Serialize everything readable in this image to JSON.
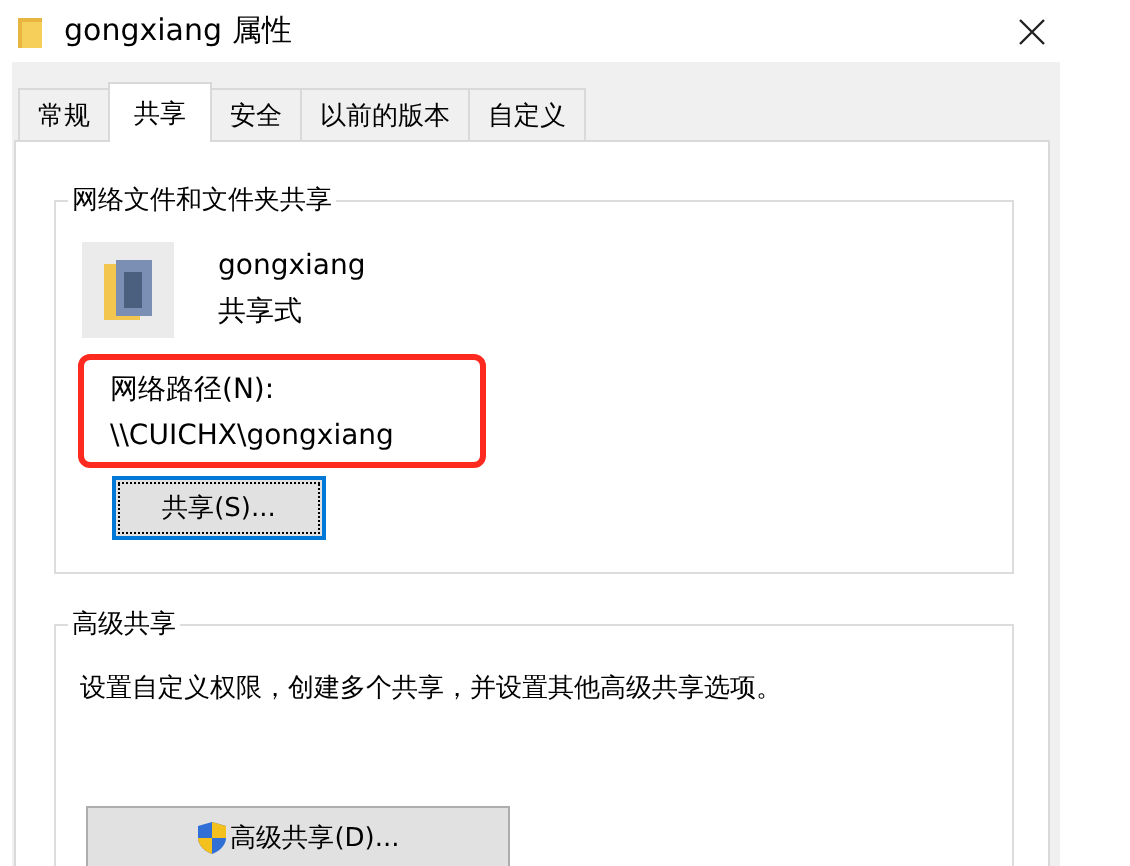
{
  "window": {
    "title": "gongxiang 属性"
  },
  "tabs": [
    {
      "label": "常规",
      "selected": false
    },
    {
      "label": "共享",
      "selected": true
    },
    {
      "label": "安全",
      "selected": false
    },
    {
      "label": "以前的版本",
      "selected": false
    },
    {
      "label": "自定义",
      "selected": false
    }
  ],
  "network_sharing": {
    "title": "网络文件和文件夹共享",
    "folder_name": "gongxiang",
    "share_status": "共享式",
    "network_path_label": "网络路径(N):",
    "network_path": "\\\\CUICHX\\gongxiang",
    "highlighted": true,
    "share_button": {
      "label": "共享(S)...",
      "focused": true
    }
  },
  "advanced_sharing": {
    "title": "高级共享",
    "description": "设置自定义权限，创建多个共享，并设置其他高级共享选项。",
    "button": {
      "label": "高级共享(D)..."
    }
  }
}
